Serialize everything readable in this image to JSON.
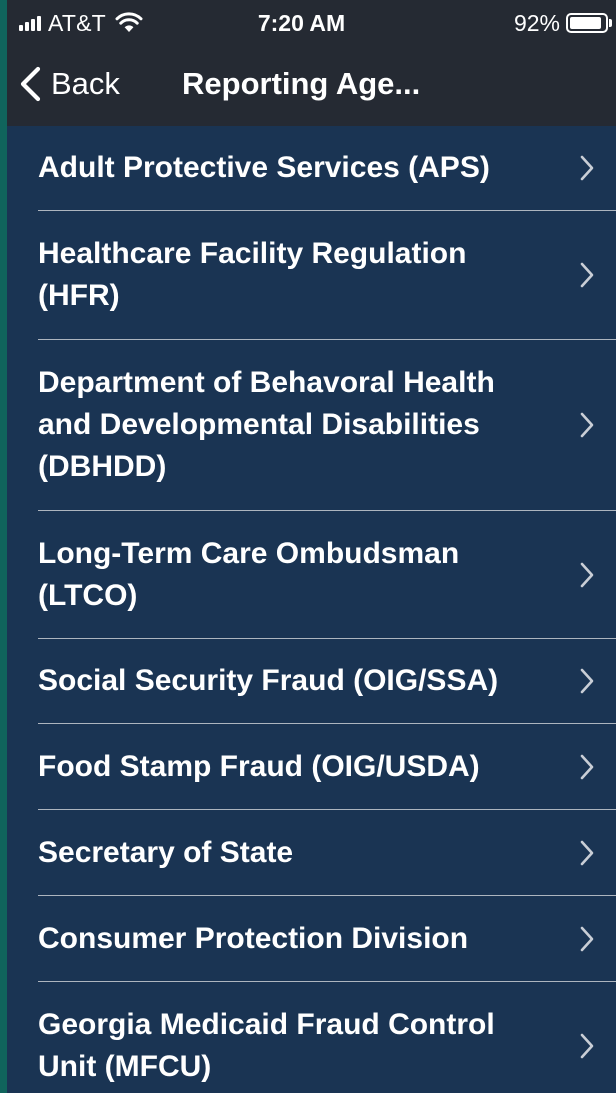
{
  "status_bar": {
    "carrier": "AT&T",
    "time": "7:20 AM",
    "battery_percent": "92%",
    "battery_level": 0.92,
    "signal_bars": 4
  },
  "nav": {
    "back_label": "Back",
    "title": "Reporting Age..."
  },
  "agencies": [
    {
      "label": "Adult Protective Services (APS)"
    },
    {
      "label": "Healthcare Facility Regulation (HFR)"
    },
    {
      "label": "Department of Behavoral Health and Developmental Disabilities (DBHDD)"
    },
    {
      "label": "Long-Term Care Ombudsman (LTCO)"
    },
    {
      "label": "Social Security Fraud (OIG/SSA)"
    },
    {
      "label": "Food Stamp Fraud (OIG/USDA)"
    },
    {
      "label": "Secretary of State"
    },
    {
      "label": "Consumer Protection Division"
    },
    {
      "label": "Georgia Medicaid Fraud Control Unit (MFCU)"
    }
  ],
  "colors": {
    "bar_background": "#252a33",
    "list_background": "#1a3453",
    "frame": "#10645c",
    "text": "#ffffff"
  },
  "icons": {
    "back": "chevron-left-icon",
    "row": "chevron-right-icon",
    "wifi": "wifi-icon",
    "signal": "signal-icon",
    "battery": "battery-icon"
  }
}
